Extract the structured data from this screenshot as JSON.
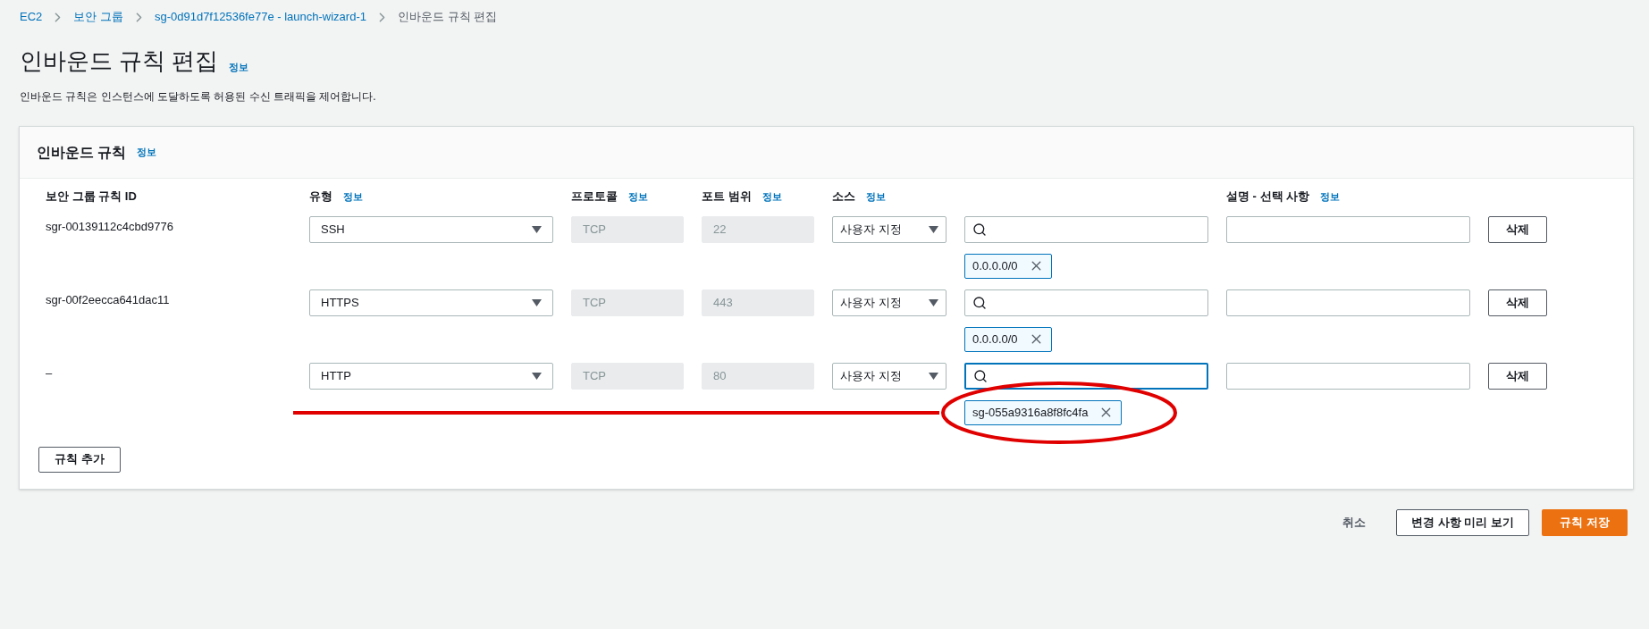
{
  "breadcrumbs": [
    {
      "label": "EC2",
      "current": false
    },
    {
      "label": "보안 그룹",
      "current": false
    },
    {
      "label": "sg-0d91d7f12536fe77e - launch-wizard-1",
      "current": false
    },
    {
      "label": "인바운드 규칙 편집",
      "current": true
    }
  ],
  "page": {
    "title": "인바운드 규칙 편집",
    "info_link": "정보",
    "description": "인바운드 규칙은 인스턴스에 도달하도록 허용된 수신 트래픽을 제어합니다."
  },
  "rules_panel": {
    "title": "인바운드 규칙",
    "info_link": "정보",
    "columns": {
      "id": {
        "label": "보안 그룹 규칙 ID"
      },
      "type": {
        "label": "유형",
        "info_link": "정보"
      },
      "protocol": {
        "label": "프로토콜",
        "info_link": "정보"
      },
      "port_range": {
        "label": "포트 범위",
        "info_link": "정보"
      },
      "source": {
        "label": "소스",
        "info_link": "정보"
      },
      "description": {
        "label": "설명 - 선택 사항",
        "info_link": "정보"
      }
    },
    "rules": [
      {
        "id": "sgr-00139112c4cbd9776",
        "type": "SSH",
        "protocol": "TCP",
        "port_range": "22",
        "source_type": "사용자 지정",
        "search_focused": false,
        "sources": [
          {
            "label": "0.0.0.0/0",
            "kind": "plain"
          }
        ],
        "delete_button": "삭제"
      },
      {
        "id": "sgr-00f2eecca641dac11",
        "type": "HTTPS",
        "protocol": "TCP",
        "port_range": "443",
        "source_type": "사용자 지정",
        "search_focused": false,
        "sources": [
          {
            "label": "0.0.0.0/0",
            "kind": "plain"
          }
        ],
        "delete_button": "삭제"
      },
      {
        "id": "–",
        "type": "HTTP",
        "protocol": "TCP",
        "port_range": "80",
        "source_type": "사용자 지정",
        "search_focused": true,
        "sources": [
          {
            "label": "sg-055a9316a8f8fc4fa",
            "kind": "circled"
          }
        ],
        "delete_button": "삭제"
      }
    ],
    "add_button": "규칙 추가"
  },
  "actions": {
    "cancel": "취소",
    "preview": "변경 사항 미리 보기",
    "save": "규칙 저장"
  }
}
